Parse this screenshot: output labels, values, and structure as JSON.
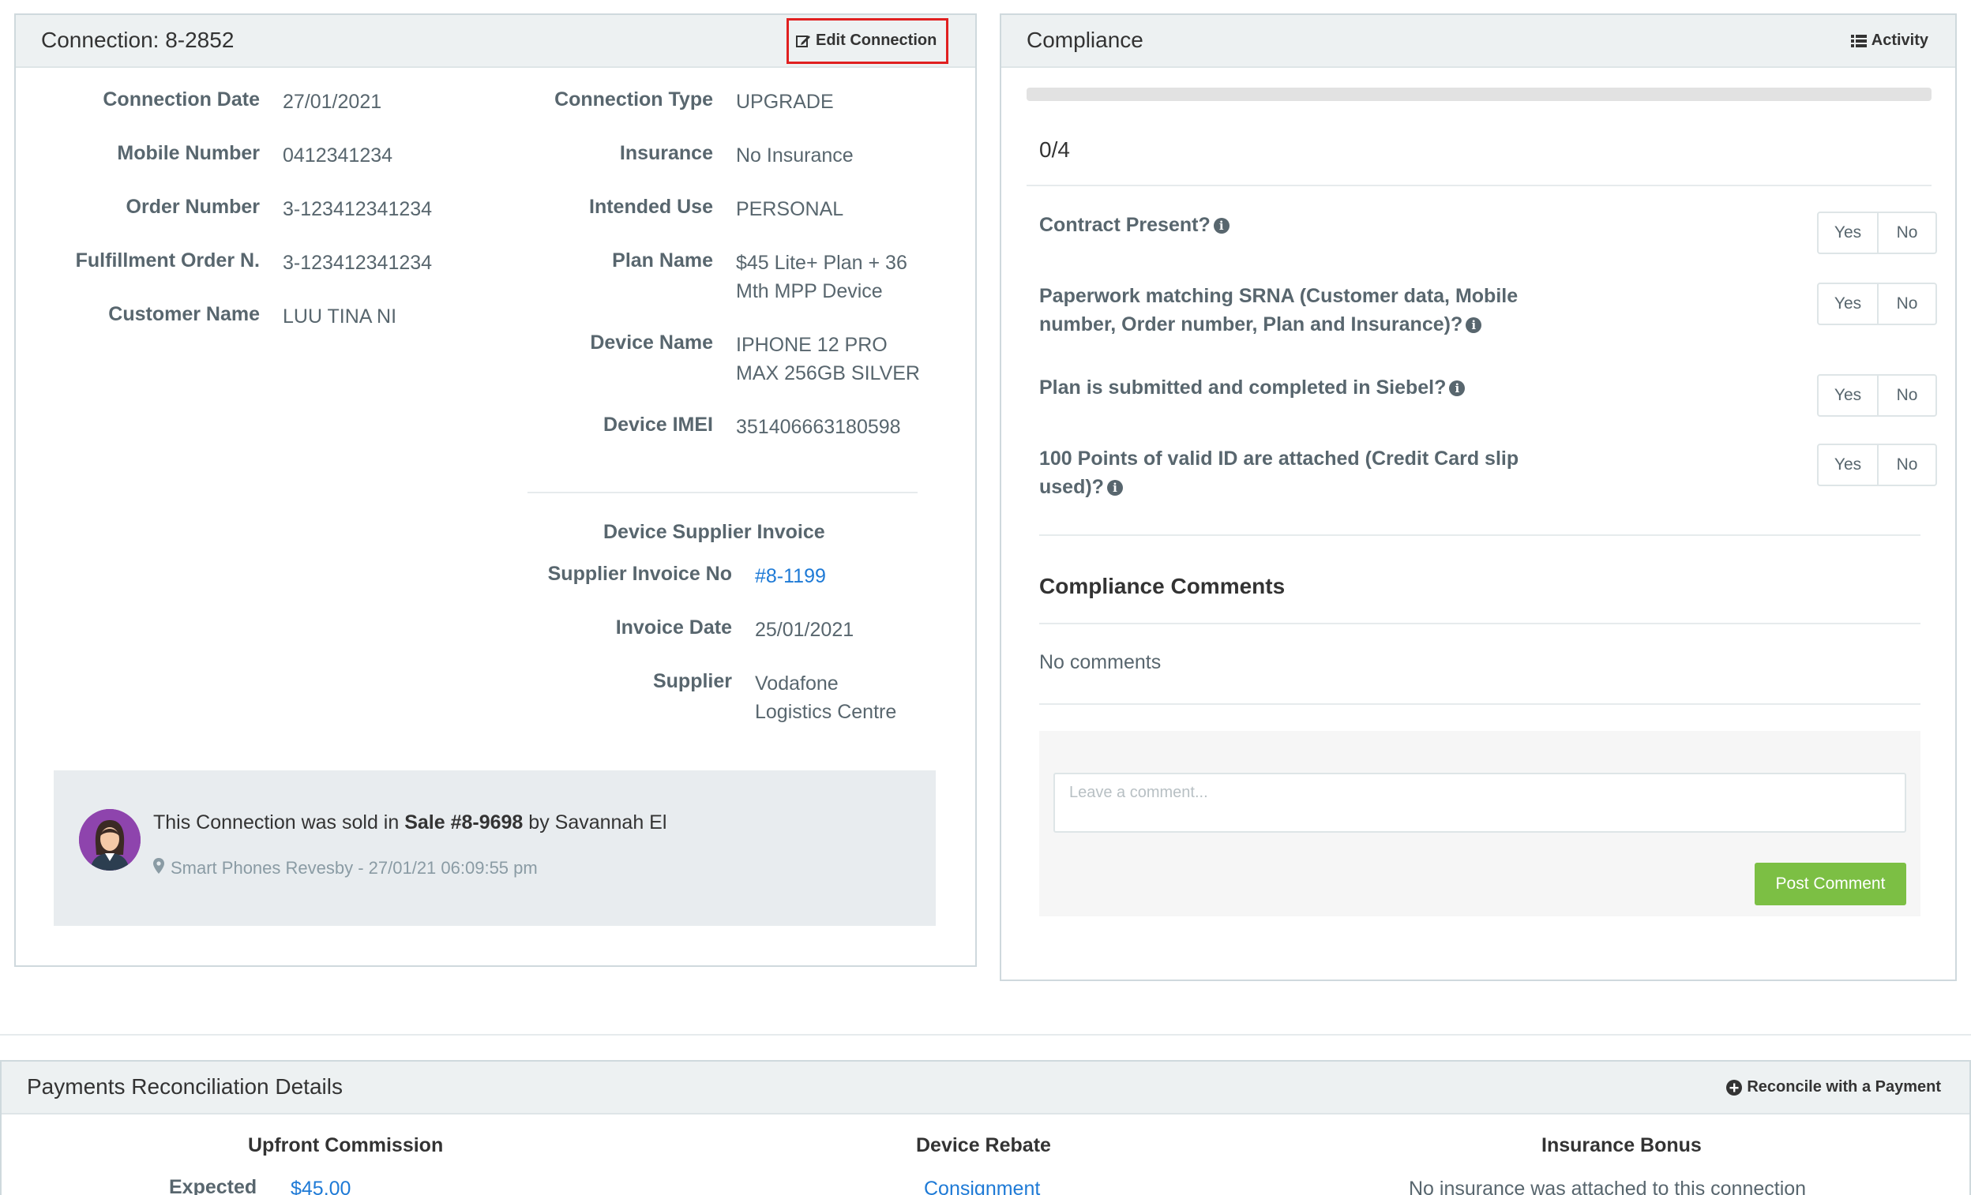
{
  "connection": {
    "title": "Connection: 8-2852",
    "edit_label": "Edit Connection",
    "left_fields": [
      {
        "label": "Connection Date",
        "value": "27/01/2021"
      },
      {
        "label": "Mobile Number",
        "value": "0412341234"
      },
      {
        "label": "Order Number",
        "value": "3-123412341234"
      },
      {
        "label": "Fulfillment Order N.",
        "value": "3-123412341234"
      },
      {
        "label": "Customer Name",
        "value": "LUU TINA NI"
      }
    ],
    "right_fields": [
      {
        "label": "Connection Type",
        "value": "UPGRADE"
      },
      {
        "label": "Insurance",
        "value": "No Insurance"
      },
      {
        "label": "Intended Use",
        "value": "PERSONAL"
      },
      {
        "label": "Plan Name",
        "value_line1": "$45 Lite+ Plan + 36",
        "value_line2": "Mth MPP Device"
      },
      {
        "label": "Device Name",
        "value_line1": "IPHONE 12 PRO",
        "value_line2": "MAX 256GB SILVER"
      },
      {
        "label": "Device IMEI",
        "value": "351406663180598"
      }
    ],
    "supplier": {
      "heading": "Device Supplier Invoice",
      "invoice_no_label": "Supplier Invoice No",
      "invoice_no": "#8-1199",
      "invoice_date_label": "Invoice Date",
      "invoice_date": "25/01/2021",
      "supplier_label": "Supplier",
      "supplier_line1": "Vodafone",
      "supplier_line2": "Logistics Centre"
    },
    "sold": {
      "prefix": "This Connection was sold in ",
      "sale": "Sale #8-9698",
      "suffix": " by Savannah El",
      "meta": "Smart Phones Revesby - 27/01/21 06:09:55 pm"
    }
  },
  "compliance": {
    "title": "Compliance",
    "activity_label": "Activity",
    "progress": {
      "done": 0,
      "total": 4,
      "text": "0/4"
    },
    "questions": [
      {
        "line1": "Contract Present?",
        "line2": ""
      },
      {
        "line1": "Paperwork matching SRNA (Customer data, Mobile",
        "line2": "number, Order number, Plan and Insurance)?"
      },
      {
        "line1": "Plan is submitted and completed in Siebel?",
        "line2": ""
      },
      {
        "line1": "100 Points of valid ID are attached (Credit Card slip",
        "line2": "used)?"
      }
    ],
    "yes_label": "Yes",
    "no_label": "No",
    "comments_heading": "Compliance Comments",
    "no_comments": "No comments",
    "comment_placeholder": "Leave a comment...",
    "post_label": "Post Comment"
  },
  "payments": {
    "title": "Payments Reconciliation Details",
    "reconcile_label": "Reconcile with a Payment",
    "upfront_heading": "Upfront Commission",
    "expected_label": "Expected",
    "expected_value": "$45.00",
    "rebate_heading": "Device Rebate",
    "rebate_value": "Consignment",
    "bonus_heading": "Insurance Bonus",
    "bonus_value": "No insurance was attached to this connection"
  }
}
